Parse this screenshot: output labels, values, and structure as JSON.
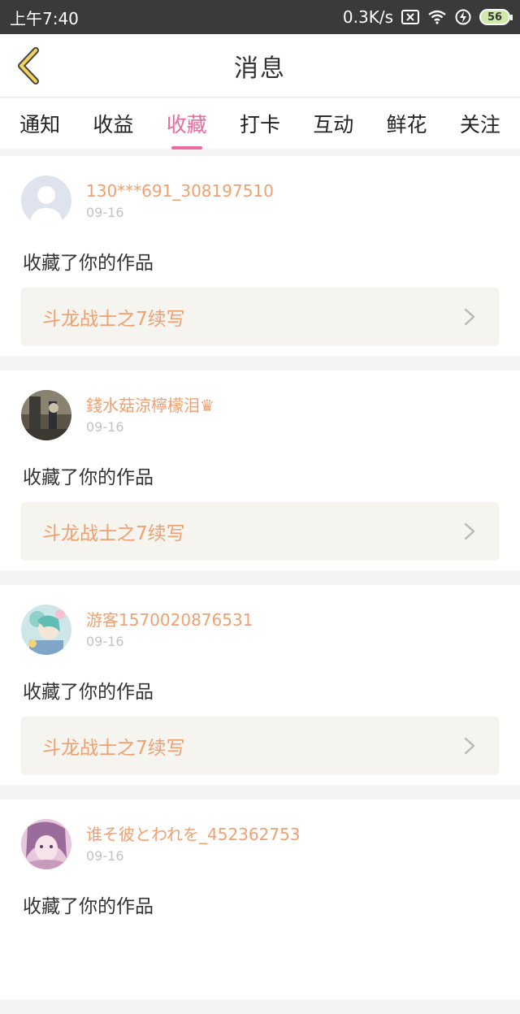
{
  "status_bar": {
    "time": "上午7:40",
    "net_speed": "0.3K/s",
    "battery_level": "56"
  },
  "header": {
    "title": "消息"
  },
  "tabs": [
    {
      "label": "通知",
      "active": false
    },
    {
      "label": "收益",
      "active": false
    },
    {
      "label": "收藏",
      "active": true
    },
    {
      "label": "打卡",
      "active": false
    },
    {
      "label": "互动",
      "active": false
    },
    {
      "label": "鲜花",
      "active": false
    },
    {
      "label": "关注",
      "active": false
    }
  ],
  "colors": {
    "accent_pink": "#e96aa0",
    "username_orange": "#f0a070",
    "status_bar_bg": "#3a3a3a"
  },
  "messages": [
    {
      "username": "130***691_308197510",
      "date": "09-16",
      "action": "收藏了你的作品",
      "work_title": "斗龙战士之7续写",
      "avatar": "default-avatar-icon"
    },
    {
      "username": "錢水菇涼檸檬泪♛",
      "date": "09-16",
      "action": "收藏了你的作品",
      "work_title": "斗龙战士之7续写",
      "avatar": "user-photo"
    },
    {
      "username": "游客1570020876531",
      "date": "09-16",
      "action": "收藏了你的作品",
      "work_title": "斗龙战士之7续写",
      "avatar": "user-photo"
    },
    {
      "username": "谁そ彼とわれを_452362753",
      "date": "09-16",
      "action": "收藏了你的作品",
      "work_title": "",
      "avatar": "user-photo"
    }
  ]
}
